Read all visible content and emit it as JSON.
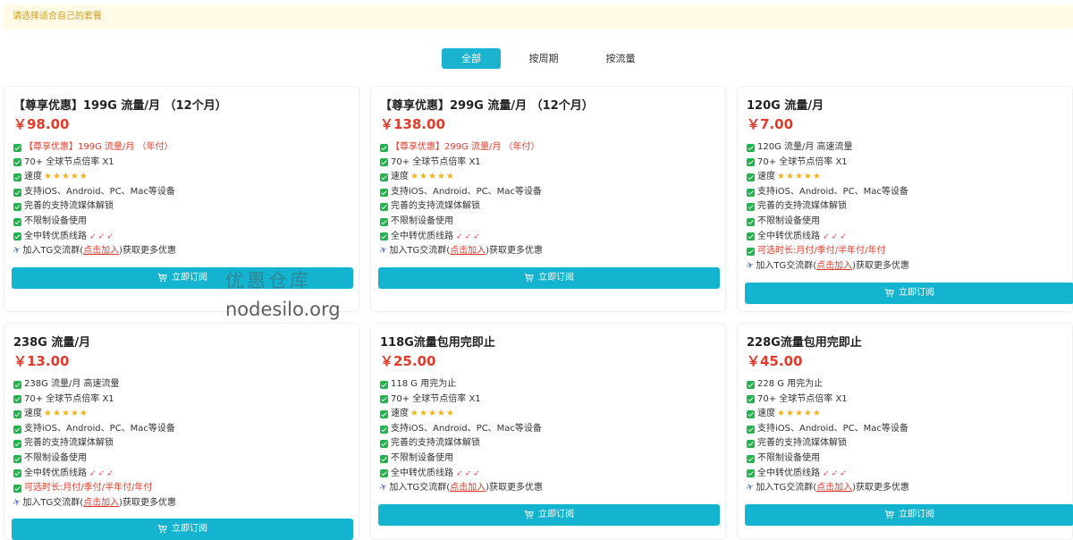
{
  "notice": "请选择适合自己的套餐",
  "tabs": [
    {
      "label": "全部",
      "active": true
    },
    {
      "label": "按周期",
      "active": false
    },
    {
      "label": "按流量",
      "active": false
    }
  ],
  "buy_label": "立即订阅",
  "join_text": {
    "prefix": "加入TG交流群(",
    "link": "点击加入",
    "suffix": ")获取更多优惠"
  },
  "cards": [
    {
      "title": "【尊享优惠】199G 流量/月 （12个月）",
      "price": "￥98.00",
      "features": [
        "【尊享优惠】199G 流量/月 （年付）",
        " 70+ 全球节点倍率 X1",
        " 速度",
        "支持iOS、Android、PC、Mac等设备",
        "完善的支持流媒体解锁",
        "不限制设备使用",
        " 全中转优质线路"
      ]
    },
    {
      "title": "【尊享优惠】299G 流量/月 （12个月）",
      "price": "￥138.00",
      "features": [
        "【尊享优惠】299G 流量/月 （年付）",
        " 70+ 全球节点倍率 X1",
        " 速度",
        "支持iOS、Android、PC、Mac等设备",
        "完善的支持流媒体解锁",
        "不限制设备使用",
        " 全中转优质线路"
      ]
    },
    {
      "title": "120G 流量/月",
      "price": "￥7.00",
      "features": [
        "120G 流量/月 高速流量",
        " 70+ 全球节点倍率 X1",
        " 速度",
        "支持iOS、Android、PC、Mac等设备",
        "完善的支持流媒体解锁",
        "不限制设备使用",
        " 全中转优质线路",
        "可选时长:月付/季付/半年付/年付"
      ]
    },
    {
      "title": "238G 流量/月",
      "price": "￥13.00",
      "features": [
        "238G 流量/月 高速流量",
        " 70+ 全球节点倍率 X1",
        " 速度",
        "支持iOS、Android、PC、Mac等设备",
        "完善的支持流媒体解锁",
        "不限制设备使用",
        " 全中转优质线路",
        "可选时长:月付/季付/半年付/年付"
      ]
    },
    {
      "title": "118G流量包用完即止",
      "price": "￥25.00",
      "features": [
        "118 G 用完为止",
        " 70+ 全球节点倍率 X1",
        " 速度",
        "支持iOS、Android、PC、Mac等设备",
        "完善的支持流媒体解锁",
        "不限制设备使用",
        " 全中转优质线路"
      ]
    },
    {
      "title": "228G流量包用完即止",
      "price": "￥45.00",
      "features": [
        "228 G 用完为止",
        " 70+ 全球节点倍率 X1",
        " 速度",
        "支持iOS、Android、PC、Mac等设备",
        "完善的支持流媒体解锁",
        "不限制设备使用",
        " 全中转优质线路"
      ]
    }
  ],
  "watermark": {
    "line1": "优惠仓库",
    "line2": "nodesilo.org"
  },
  "colors": {
    "accent": "#14b3d0",
    "price": "#e03b2a",
    "check": "#22b34c",
    "star": "#f5b41e"
  },
  "icons": {
    "check": "check-square-icon",
    "star": "star-icon",
    "rocket": "rocket-icon",
    "plane": "paper-plane-icon",
    "cart": "cart-icon"
  }
}
